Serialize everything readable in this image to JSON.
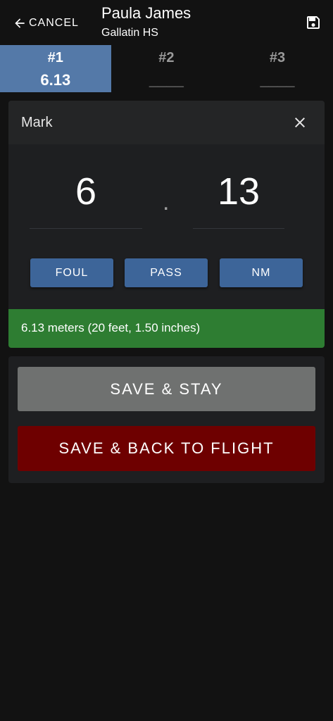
{
  "header": {
    "cancel_label": "CANCEL",
    "athlete_name": "Paula James",
    "athlete_school": "Gallatin HS"
  },
  "attempts": [
    {
      "number": "#1",
      "value": "6.13",
      "active": true
    },
    {
      "number": "#2",
      "value": "____",
      "active": false
    },
    {
      "number": "#3",
      "value": "____",
      "active": false
    }
  ],
  "mark": {
    "title": "Mark",
    "whole": "6",
    "separator": ".",
    "fraction": "13",
    "buttons": {
      "foul": "FOUL",
      "pass": "PASS",
      "nm": "NM"
    },
    "conversion": "6.13 meters (20 feet, 1.50 inches)"
  },
  "actions": {
    "save_stay": "SAVE & STAY",
    "save_back": "SAVE & BACK TO FLIGHT"
  },
  "colors": {
    "accent_tab": "#5479a8",
    "pill_button": "#3d6599",
    "success": "#2e7d32",
    "danger": "#6e0000",
    "neutral_button": "#6f7170"
  },
  "icons": [
    "arrow-left-icon",
    "save-icon",
    "close-icon"
  ]
}
